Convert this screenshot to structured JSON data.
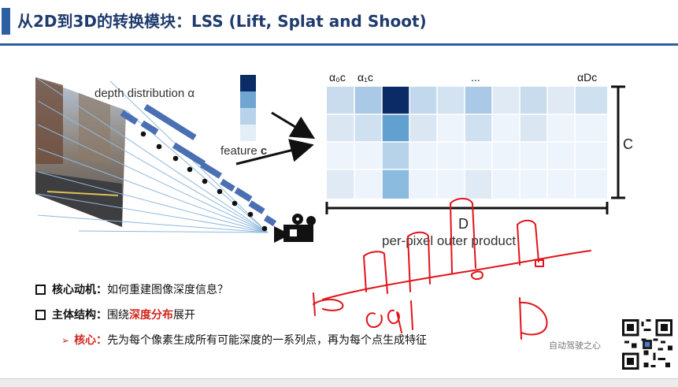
{
  "title": "从2D到3D的转换模块：LSS (Lift, Splat and Shoot)",
  "diagram": {
    "depth_label": "depth distribution α",
    "feature_label": "feature",
    "feature_bold": "c",
    "col_labels": {
      "a0": "α₀c",
      "a1": "α₁c",
      "dots": "...",
      "aD": "αDc"
    },
    "c_label": "C",
    "d_label": "D",
    "outer_product_label": "per-pixel outer product"
  },
  "bullets": [
    {
      "key": "核心动机：",
      "text": "如何重建图像深度信息？"
    },
    {
      "key": "主体结构：",
      "prefix": "围绕",
      "highlight": "深度分布",
      "suffix": "展开"
    }
  ],
  "sub_bullet": {
    "key": "核心：",
    "text": "先为每个像素生成所有可能深度的一系列点，再为每个点生成特征"
  },
  "watermark": "自动驾驶之心",
  "colors": {
    "title": "#1f3b6e",
    "accent": "#2e5fa5",
    "highlight": "#d0261d",
    "ink": "#e0141a"
  }
}
